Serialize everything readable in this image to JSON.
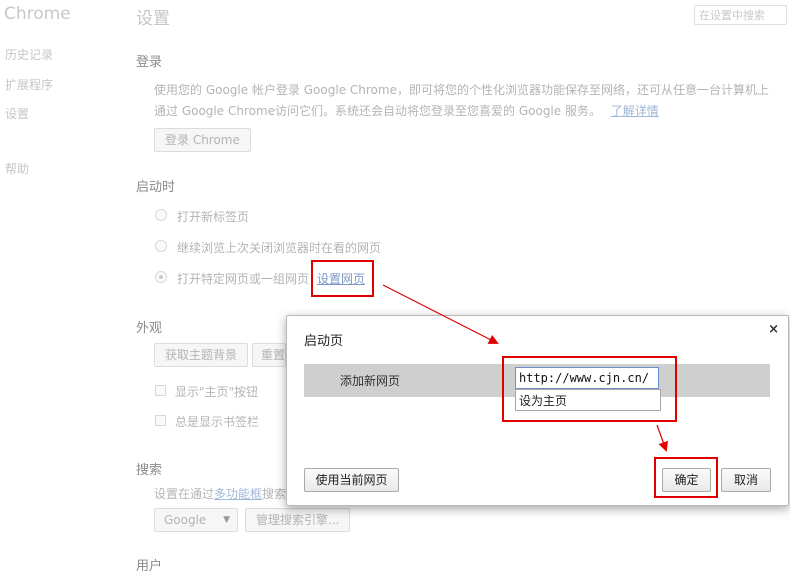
{
  "app": {
    "brand": "Chrome"
  },
  "sidebar": {
    "items": [
      {
        "label": "历史记录"
      },
      {
        "label": "扩展程序"
      },
      {
        "label": "设置"
      },
      {
        "label": "帮助"
      }
    ]
  },
  "header": {
    "title": "设置",
    "search_placeholder": "在设置中搜索"
  },
  "signin": {
    "heading": "登录",
    "line1": "使用您的 Google 帐户登录 Google Chrome，即可将您的个性化浏览器功能保存至网络，还可从任意一台计算机上",
    "line2": "通过 Google Chrome访问它们。系统还会自动将您登录至您喜爱的 Google 服务。",
    "learn_more": "了解详情",
    "button": "登录 Chrome"
  },
  "startup": {
    "heading": "启动时",
    "options": [
      {
        "label": "打开新标签页",
        "selected": false
      },
      {
        "label": "继续浏览上次关闭浏览器时在看的网页",
        "selected": false
      },
      {
        "label": "打开特定网页或一组网页",
        "selected": true
      }
    ],
    "set_pages_link": "设置网页"
  },
  "appearance": {
    "heading": "外观",
    "get_themes": "获取主题背景",
    "reset": "重置",
    "show_home": "显示\"主页\"按钮",
    "show_bookmarks": "总是显示书签栏"
  },
  "search": {
    "heading": "搜索",
    "text_before": "设置在通过",
    "omnibox_link": "多功能框",
    "text_after": "搜索",
    "engine": "Google",
    "manage_button": "管理搜索引擎..."
  },
  "users": {
    "heading": "用户"
  },
  "dialog": {
    "title": "启动页",
    "close": "×",
    "add_page_label": "添加新网页",
    "url_value": "http://www.cjn.cn/",
    "suggestion": "设为主页",
    "use_current": "使用当前网页",
    "ok": "确定",
    "cancel": "取消"
  },
  "colors": {
    "annotation_red": "#e00000",
    "dialog_row_bg": "#cfcfcf"
  }
}
